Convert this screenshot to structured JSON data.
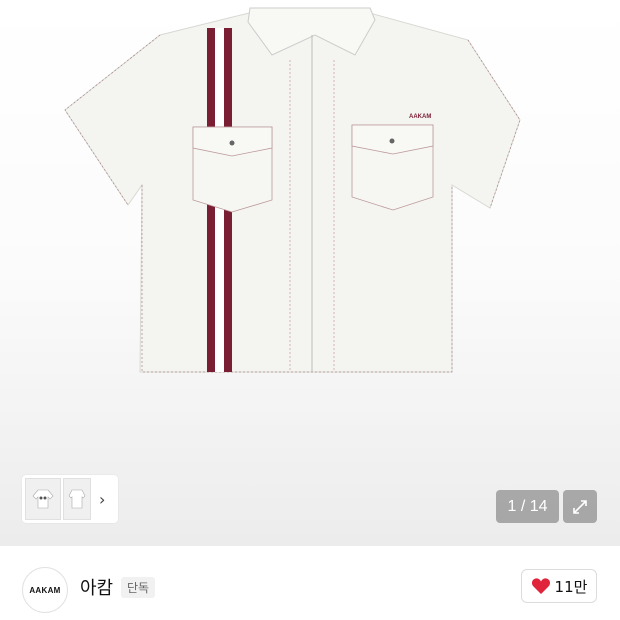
{
  "gallery": {
    "counter": "1 / 14",
    "stripe_color": "#7a1e34",
    "shirt_logo_text": "AAKAM"
  },
  "thumbnails": {
    "next_icon": "chevron-right-icon"
  },
  "brand": {
    "logo_text": "AAKAM",
    "name": "아캄",
    "badge": "단독"
  },
  "like": {
    "count": "11만",
    "icon": "heart-icon",
    "icon_color": "#e0243c"
  }
}
